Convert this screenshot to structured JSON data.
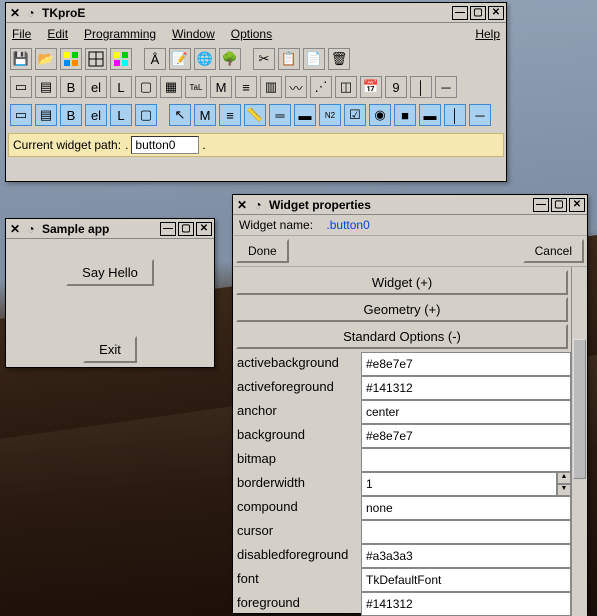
{
  "main_window": {
    "title": "TKproE",
    "menus": {
      "file": "File",
      "edit": "Edit",
      "prog": "Programming",
      "win": "Window",
      "opt": "Options",
      "help": "Help"
    },
    "path_label": "Current widget path:",
    "path_prefix": ".",
    "path_value": "button0",
    "path_suffix": "."
  },
  "sample_window": {
    "title": "Sample app",
    "btn_hello": "Say Hello",
    "btn_exit": "Exit"
  },
  "props_window": {
    "title": "Widget properties",
    "name_label": "Widget name:",
    "name_value": ".button0",
    "btn_done": "Done",
    "btn_cancel": "Cancel",
    "section_widget": "Widget (+)",
    "section_geometry": "Geometry (+)",
    "section_std": "Standard Options (-)",
    "props": [
      {
        "label": "activebackground",
        "value": "#e8e7e7"
      },
      {
        "label": "activeforeground",
        "value": "#141312"
      },
      {
        "label": "anchor",
        "value": "center"
      },
      {
        "label": "background",
        "value": "#e8e7e7"
      },
      {
        "label": "bitmap",
        "value": ""
      },
      {
        "label": "borderwidth",
        "value": "1",
        "spinner": true
      },
      {
        "label": "compound",
        "value": "none"
      },
      {
        "label": "cursor",
        "value": ""
      },
      {
        "label": "disabledforeground",
        "value": "#a3a3a3"
      },
      {
        "label": "font",
        "value": "TkDefaultFont"
      },
      {
        "label": "foreground",
        "value": "#141312"
      }
    ]
  }
}
